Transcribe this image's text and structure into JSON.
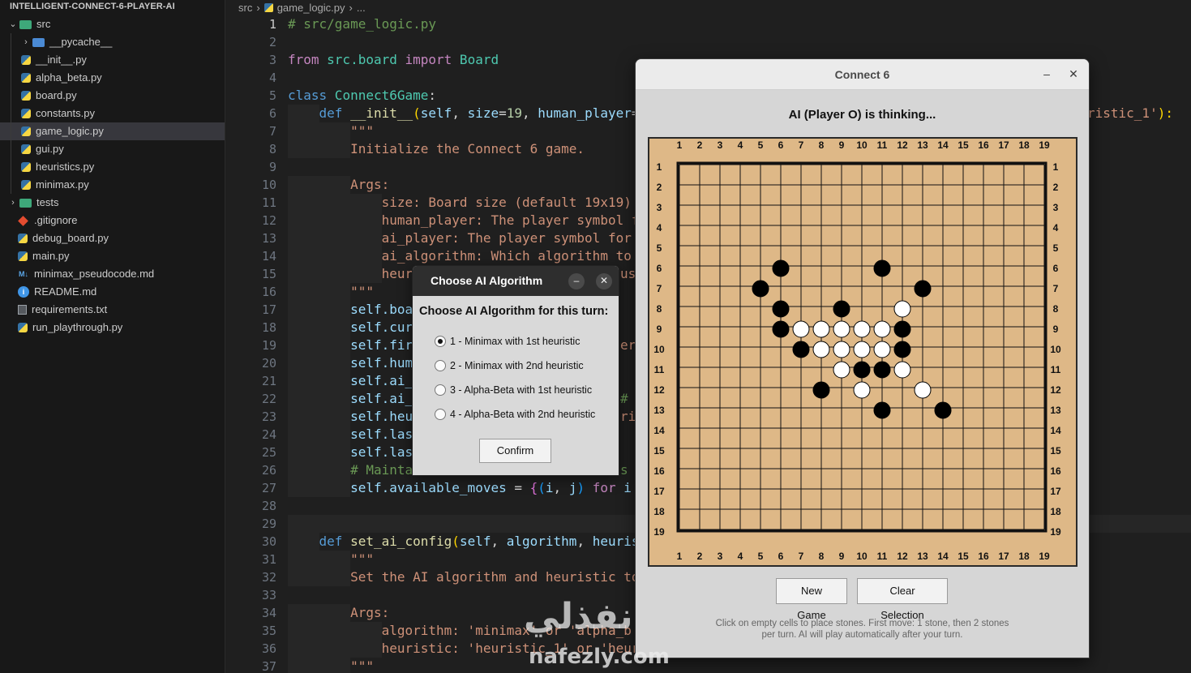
{
  "explorer": {
    "project": "INTELLIGENT-CONNECT-6-PLAYER-AI",
    "items": [
      {
        "label": "src",
        "icon": "folder-src-icon",
        "chevron": "⌄",
        "depth": 0
      },
      {
        "label": "__pycache__",
        "icon": "folder-icon",
        "chevron": "›",
        "depth": 1
      },
      {
        "label": "__init__.py",
        "icon": "python-file-icon",
        "depth": 1
      },
      {
        "label": "alpha_beta.py",
        "icon": "python-file-icon",
        "depth": 1
      },
      {
        "label": "board.py",
        "icon": "python-file-icon",
        "depth": 1
      },
      {
        "label": "constants.py",
        "icon": "python-file-icon",
        "depth": 1
      },
      {
        "label": "game_logic.py",
        "icon": "python-file-icon",
        "depth": 1,
        "selected": true
      },
      {
        "label": "gui.py",
        "icon": "python-file-icon",
        "depth": 1
      },
      {
        "label": "heuristics.py",
        "icon": "python-file-icon",
        "depth": 1
      },
      {
        "label": "minimax.py",
        "icon": "python-file-icon",
        "depth": 1
      },
      {
        "label": "tests",
        "icon": "folder-test-icon",
        "chevron": "›",
        "depth": 0
      },
      {
        "label": ".gitignore",
        "icon": "git-icon",
        "depth": 0
      },
      {
        "label": "debug_board.py",
        "icon": "python-file-icon",
        "depth": 0
      },
      {
        "label": "main.py",
        "icon": "python-file-icon",
        "depth": 0
      },
      {
        "label": "minimax_pseudocode.md",
        "icon": "markdown-icon",
        "depth": 0
      },
      {
        "label": "README.md",
        "icon": "info-icon",
        "depth": 0
      },
      {
        "label": "requirements.txt",
        "icon": "text-file-icon",
        "depth": 0
      },
      {
        "label": "run_playthrough.py",
        "icon": "python-file-icon",
        "depth": 0
      }
    ]
  },
  "editor": {
    "breadcrumb": [
      "src",
      "game_logic.py",
      "..."
    ],
    "current_line": 1,
    "lines": [
      {
        "n": "1",
        "indent": 0,
        "tokens": [
          [
            "# src/game_logic.py",
            "#6a9955"
          ]
        ]
      },
      {
        "n": "2",
        "indent": 0,
        "tokens": []
      },
      {
        "n": "3",
        "indent": 0,
        "tokens": [
          [
            "from",
            "#c586c0"
          ],
          [
            " src.board ",
            "#4ec9b0"
          ],
          [
            "import",
            "#c586c0"
          ],
          [
            " Board",
            "#4ec9b0"
          ]
        ]
      },
      {
        "n": "4",
        "indent": 0,
        "tokens": []
      },
      {
        "n": "5",
        "indent": 0,
        "tokens": [
          [
            "class",
            "#569cd6"
          ],
          [
            " Connect6Game",
            "#4ec9b0"
          ],
          [
            ":",
            "#d4d4d4"
          ]
        ]
      },
      {
        "n": "6",
        "indent": 4,
        "tokens": [
          [
            "def",
            "#569cd6"
          ],
          [
            " __init__",
            "#dcdcaa"
          ],
          [
            "(",
            "#ffd700"
          ],
          [
            "self",
            "#9cdcfe"
          ],
          [
            ", ",
            "#d4d4d4"
          ],
          [
            "size",
            "#9cdcfe"
          ],
          [
            "=",
            "#d4d4d4"
          ],
          [
            "19",
            "#b5cea8"
          ],
          [
            ", ",
            "#d4d4d4"
          ],
          [
            "human_player",
            "#9cdcfe"
          ],
          [
            "=",
            "#d4d4d4"
          ]
        ]
      },
      {
        "n": "7",
        "indent": 8,
        "tokens": [
          [
            "\"\"\"",
            "#ce9178"
          ]
        ]
      },
      {
        "n": "8",
        "indent": 8,
        "tokens": [
          [
            "Initialize the Connect 6 game.",
            "#ce9178"
          ]
        ]
      },
      {
        "n": "9",
        "indent": 0,
        "tokens": []
      },
      {
        "n": "10",
        "indent": 8,
        "tokens": [
          [
            "Args:",
            "#ce9178"
          ]
        ]
      },
      {
        "n": "11",
        "indent": 12,
        "tokens": [
          [
            "size: Board size (default 19x19)",
            "#ce9178"
          ]
        ]
      },
      {
        "n": "12",
        "indent": 12,
        "tokens": [
          [
            "human_player: The player symbol f",
            "#ce9178"
          ]
        ]
      },
      {
        "n": "13",
        "indent": 12,
        "tokens": [
          [
            "ai_player: The player symbol for",
            "#ce9178"
          ]
        ]
      },
      {
        "n": "14",
        "indent": 12,
        "tokens": [
          [
            "ai_algorithm: Which algorithm to",
            "#ce9178"
          ]
        ]
      },
      {
        "n": "15",
        "indent": 12,
        "tokens": [
          [
            "heur",
            "#ce9178"
          ]
        ]
      },
      {
        "n": "16",
        "indent": 8,
        "tokens": [
          [
            "\"\"\"",
            "#ce9178"
          ]
        ]
      },
      {
        "n": "17",
        "indent": 8,
        "tokens": [
          [
            "self",
            "#9cdcfe"
          ],
          [
            ".boa",
            "#9cdcfe"
          ]
        ]
      },
      {
        "n": "18",
        "indent": 8,
        "tokens": [
          [
            "self",
            "#9cdcfe"
          ],
          [
            ".cur",
            "#9cdcfe"
          ]
        ]
      },
      {
        "n": "19",
        "indent": 8,
        "tokens": [
          [
            "self",
            "#9cdcfe"
          ],
          [
            ".fir",
            "#9cdcfe"
          ]
        ]
      },
      {
        "n": "20",
        "indent": 8,
        "tokens": [
          [
            "self",
            "#9cdcfe"
          ],
          [
            ".hum",
            "#9cdcfe"
          ]
        ]
      },
      {
        "n": "21",
        "indent": 8,
        "tokens": [
          [
            "self",
            "#9cdcfe"
          ],
          [
            ".ai_",
            "#9cdcfe"
          ]
        ]
      },
      {
        "n": "22",
        "indent": 8,
        "tokens": [
          [
            "self",
            "#9cdcfe"
          ],
          [
            ".ai_",
            "#9cdcfe"
          ]
        ]
      },
      {
        "n": "23",
        "indent": 8,
        "tokens": [
          [
            "self",
            "#9cdcfe"
          ],
          [
            ".heu",
            "#9cdcfe"
          ]
        ]
      },
      {
        "n": "24",
        "indent": 8,
        "tokens": [
          [
            "self",
            "#9cdcfe"
          ],
          [
            ".las",
            "#9cdcfe"
          ]
        ]
      },
      {
        "n": "25",
        "indent": 8,
        "tokens": [
          [
            "self",
            "#9cdcfe"
          ],
          [
            ".las",
            "#9cdcfe"
          ]
        ]
      },
      {
        "n": "26",
        "indent": 8,
        "tokens": [
          [
            "# Mainta",
            "#6a9955"
          ]
        ]
      },
      {
        "n": "27",
        "indent": 8,
        "tokens": [
          [
            "self",
            "#9cdcfe"
          ],
          [
            ".available_moves",
            "#9cdcfe"
          ],
          [
            " = ",
            "#d4d4d4"
          ],
          [
            "{",
            "#da70d6"
          ],
          [
            "(",
            "#179fff"
          ],
          [
            "i",
            "#9cdcfe"
          ],
          [
            ", ",
            "#d4d4d4"
          ],
          [
            "j",
            "#9cdcfe"
          ],
          [
            ")",
            "#179fff"
          ],
          [
            " for",
            "#c586c0"
          ],
          [
            " i",
            "#9cdcfe"
          ]
        ]
      },
      {
        "n": "28",
        "indent": 0,
        "tokens": []
      },
      {
        "n": "29",
        "indent": 0,
        "tokens": [],
        "highlight": true
      },
      {
        "n": "30",
        "indent": 4,
        "tokens": [
          [
            "def",
            "#569cd6"
          ],
          [
            " set_ai_config",
            "#dcdcaa"
          ],
          [
            "(",
            "#ffd700"
          ],
          [
            "self",
            "#9cdcfe"
          ],
          [
            ", ",
            "#d4d4d4"
          ],
          [
            "algorithm",
            "#9cdcfe"
          ],
          [
            ", ",
            "#d4d4d4"
          ],
          [
            "heuris",
            "#9cdcfe"
          ]
        ]
      },
      {
        "n": "31",
        "indent": 8,
        "tokens": [
          [
            "\"\"\"",
            "#ce9178"
          ]
        ]
      },
      {
        "n": "32",
        "indent": 8,
        "tokens": [
          [
            "Set the AI algorithm and heuristic to",
            "#ce9178"
          ]
        ]
      },
      {
        "n": "33",
        "indent": 0,
        "tokens": []
      },
      {
        "n": "34",
        "indent": 8,
        "tokens": [
          [
            "Args:",
            "#ce9178"
          ]
        ]
      },
      {
        "n": "35",
        "indent": 12,
        "tokens": [
          [
            "algorithm: 'minimax' or 'alpha_b",
            "#ce9178"
          ]
        ]
      },
      {
        "n": "36",
        "indent": 12,
        "tokens": [
          [
            "heuristic: 'heuristic_1' or 'heur",
            "#ce9178"
          ]
        ]
      },
      {
        "n": "37",
        "indent": 8,
        "tokens": [
          [
            "\"\"\"",
            "#ce9178"
          ]
        ]
      }
    ],
    "right_overflow": {
      "line": 6,
      "text": "ristic_1'):",
      "string_part": "ristic_1'",
      "rest": "):"
    },
    "right_fragments": [
      {
        "line": 15,
        "text": "use"
      },
      {
        "line": 19,
        "text": "er"
      },
      {
        "line": 22,
        "text": "# "
      },
      {
        "line": 23,
        "text": "ris"
      },
      {
        "line": 26,
        "text": "s t"
      }
    ]
  },
  "connect6": {
    "title": "Connect 6",
    "minimize": "–",
    "close": "✕",
    "status": "AI (Player O) is thinking...",
    "board": {
      "size": 19,
      "col_labels": [
        "1",
        "2",
        "3",
        "4",
        "5",
        "6",
        "7",
        "8",
        "9",
        "10",
        "11",
        "12",
        "13",
        "14",
        "15",
        "16",
        "17",
        "18",
        "19"
      ],
      "row_labels": [
        "1",
        "2",
        "3",
        "4",
        "5",
        "6",
        "7",
        "8",
        "9",
        "10",
        "11",
        "12",
        "13",
        "14",
        "15",
        "16",
        "17",
        "18",
        "19"
      ],
      "colors": {
        "wood": "#deb887",
        "line": "#111111",
        "black": "#000000",
        "white": "#ffffff"
      },
      "black_stones": [
        [
          6,
          6
        ],
        [
          6,
          11
        ],
        [
          7,
          5
        ],
        [
          7,
          13
        ],
        [
          8,
          6
        ],
        [
          8,
          9
        ],
        [
          9,
          6
        ],
        [
          9,
          12
        ],
        [
          10,
          7
        ],
        [
          10,
          12
        ],
        [
          11,
          10
        ],
        [
          11,
          11
        ],
        [
          12,
          8
        ],
        [
          13,
          11
        ],
        [
          13,
          14
        ]
      ],
      "white_stones": [
        [
          8,
          12
        ],
        [
          9,
          7
        ],
        [
          9,
          8
        ],
        [
          9,
          9
        ],
        [
          9,
          10
        ],
        [
          9,
          11
        ],
        [
          10,
          8
        ],
        [
          10,
          9
        ],
        [
          10,
          10
        ],
        [
          10,
          11
        ],
        [
          11,
          9
        ],
        [
          11,
          12
        ],
        [
          12,
          10
        ],
        [
          12,
          13
        ]
      ]
    },
    "buttons": {
      "new_game": "New Game",
      "clear_selection": "Clear Selection"
    },
    "help_line1": "Click on empty cells to place stones. First move: 1 stone, then 2 stones",
    "help_line2": "per turn. AI will play automatically after your turn."
  },
  "dialog": {
    "title": "Choose AI Algorithm",
    "minimize": "–",
    "close": "✕",
    "prompt": "Choose AI Algorithm for this turn:",
    "options": [
      {
        "label": "1 - Minimax with 1st heuristic",
        "selected": true
      },
      {
        "label": "2 - Minimax with 2nd heuristic",
        "selected": false
      },
      {
        "label": "3 - Alpha-Beta with 1st heuristic",
        "selected": false
      },
      {
        "label": "4 - Alpha-Beta with 2nd heuristic",
        "selected": false
      }
    ],
    "confirm": "Confirm"
  },
  "watermark": {
    "arabic": "نفذلي",
    "latin": "nafezly.com"
  }
}
